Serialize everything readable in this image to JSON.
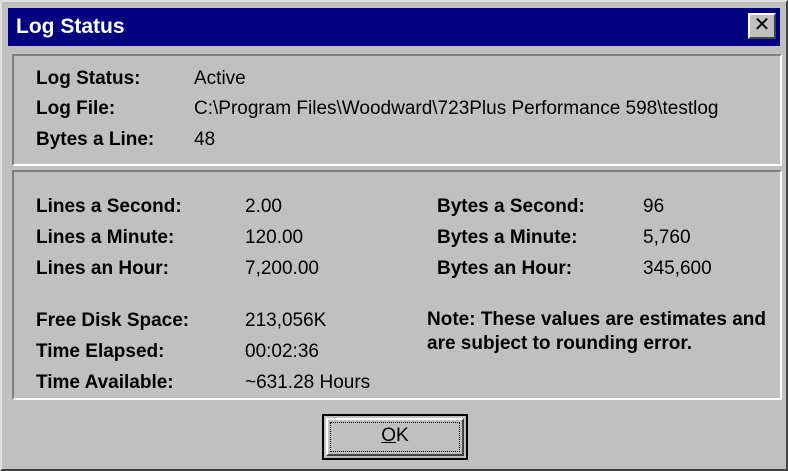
{
  "window": {
    "title": "Log Status",
    "close_icon": "close-icon",
    "close_glyph": "✕"
  },
  "header_info": {
    "status_label": "Log Status:",
    "status_value": "Active",
    "file_label": "Log File:",
    "file_value": "C:\\Program Files\\Woodward\\723Plus Performance 598\\testlog",
    "bytes_line_label": "Bytes a Line:",
    "bytes_line_value": "48"
  },
  "rates": {
    "lines_second_label": "Lines a Second:",
    "lines_second_value": "2.00",
    "lines_minute_label": "Lines a Minute:",
    "lines_minute_value": "120.00",
    "lines_hour_label": "Lines an Hour:",
    "lines_hour_value": "7,200.00",
    "bytes_second_label": "Bytes a Second:",
    "bytes_second_value": "96",
    "bytes_minute_label": "Bytes a Minute:",
    "bytes_minute_value": "5,760",
    "bytes_hour_label": "Bytes an Hour:",
    "bytes_hour_value": "345,600"
  },
  "disk": {
    "free_label": "Free Disk Space:",
    "free_value": "213,056K",
    "elapsed_label": "Time Elapsed:",
    "elapsed_value": "00:02:36",
    "available_label": "Time Available:",
    "available_value": "~631.28 Hours"
  },
  "note": "Note: These values are estimates and are subject to rounding error.",
  "buttons": {
    "ok_accel": "O",
    "ok_rest": "K"
  },
  "colors": {
    "titlebar": "#000080",
    "face": "#c0c0c0"
  }
}
